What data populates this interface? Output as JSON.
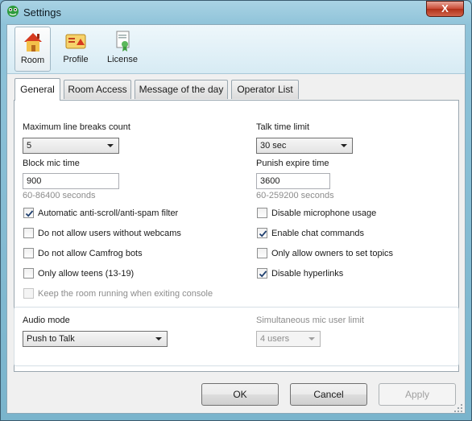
{
  "window": {
    "title": "Settings",
    "close_label": "X"
  },
  "toolbar": {
    "items": [
      {
        "label": "Room",
        "icon": "house-icon",
        "selected": true
      },
      {
        "label": "Profile",
        "icon": "profile-card-icon",
        "selected": false
      },
      {
        "label": "License",
        "icon": "license-certificate-icon",
        "selected": false
      }
    ]
  },
  "tabs": [
    "General",
    "Room Access",
    "Message of the day",
    "Operator List"
  ],
  "general": {
    "max_line_breaks": {
      "label": "Maximum line breaks count",
      "value": "5"
    },
    "talk_time_limit": {
      "label": "Talk time limit",
      "value": "30 sec"
    },
    "block_mic_time": {
      "label": "Block mic time",
      "value": "900",
      "hint": "60-86400 seconds"
    },
    "punish_expire_time": {
      "label": "Punish expire time",
      "value": "3600",
      "hint": "60-259200 seconds"
    },
    "checkboxes_left": [
      {
        "label": "Automatic anti-scroll/anti-spam filter",
        "checked": true
      },
      {
        "label": "Do not allow users without webcams",
        "checked": false
      },
      {
        "label": "Do not allow Camfrog bots",
        "checked": false
      },
      {
        "label": "Only allow teens (13-19)",
        "checked": false
      }
    ],
    "checkboxes_right": [
      {
        "label": "Disable microphone usage",
        "checked": false
      },
      {
        "label": "Enable chat commands",
        "checked": true
      },
      {
        "label": "Only allow owners to set topics",
        "checked": false
      },
      {
        "label": "Disable hyperlinks",
        "checked": true
      }
    ],
    "keep_running": {
      "label": "Keep the room running when exiting console",
      "checked": false
    }
  },
  "audio": {
    "mode_label": "Audio mode",
    "mode_value": "Push to Talk",
    "mic_limit_label": "Simultaneous mic user limit",
    "mic_limit_value": "4 users"
  },
  "buttons": {
    "ok": "OK",
    "cancel": "Cancel",
    "apply": "Apply"
  }
}
